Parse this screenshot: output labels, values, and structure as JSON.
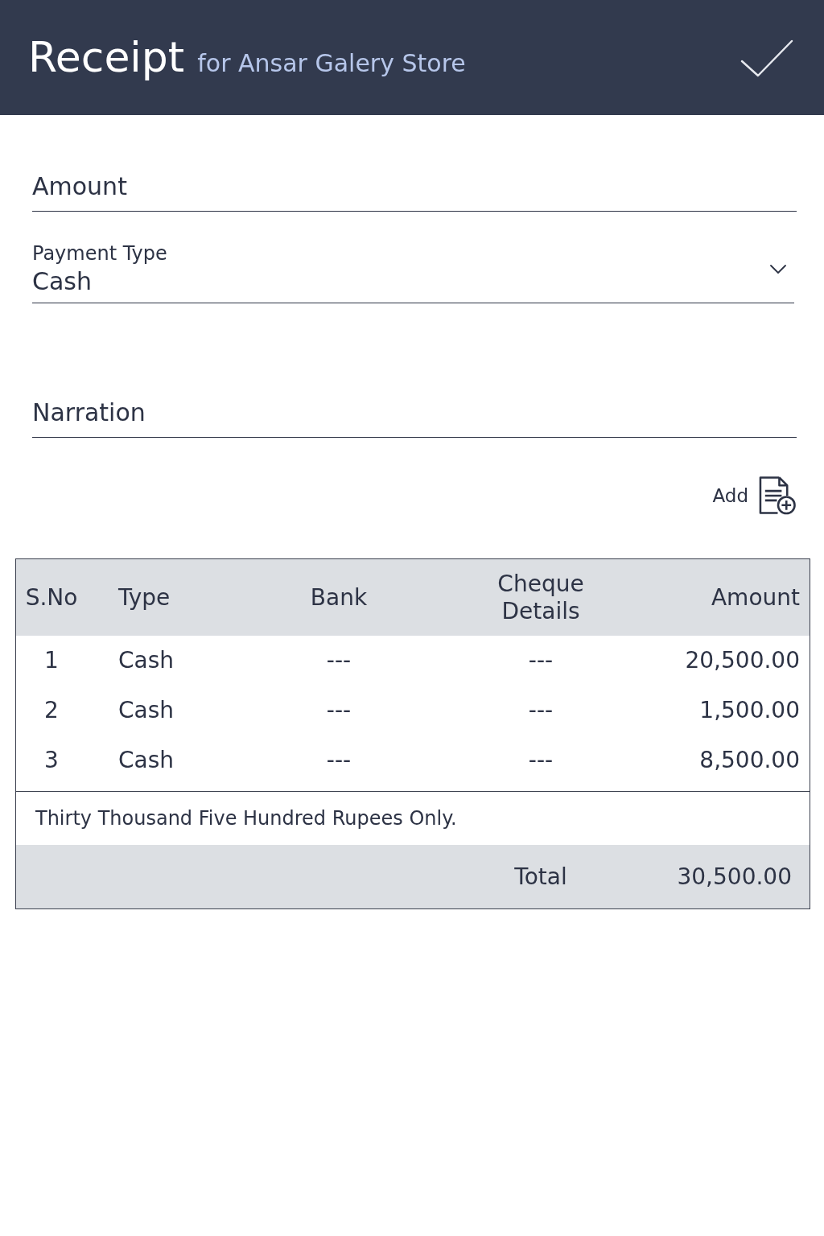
{
  "header": {
    "title": "Receipt",
    "subtitle": "for Ansar Galery Store"
  },
  "form": {
    "fields": [
      {
        "kind": "text",
        "placeholder": "Amount"
      },
      {
        "kind": "select",
        "label": "Payment Type",
        "value": "Cash"
      },
      {
        "kind": "text",
        "placeholder": "Narration"
      }
    ]
  },
  "add_button": {
    "label": "Add"
  },
  "table": {
    "columns": [
      "S.No",
      "Type",
      "Bank",
      "Cheque Details",
      "Amount"
    ],
    "rows": [
      [
        "1",
        "Cash",
        "---",
        "---",
        "20,500.00"
      ],
      [
        "2",
        "Cash",
        "---",
        "---",
        "1,500.00"
      ],
      [
        "3",
        "Cash",
        "---",
        "---",
        "8,500.00"
      ]
    ],
    "amount_in_words": "Thirty Thousand Five Hundred Rupees Only.",
    "total_label": "Total",
    "total": "30,500.00"
  }
}
